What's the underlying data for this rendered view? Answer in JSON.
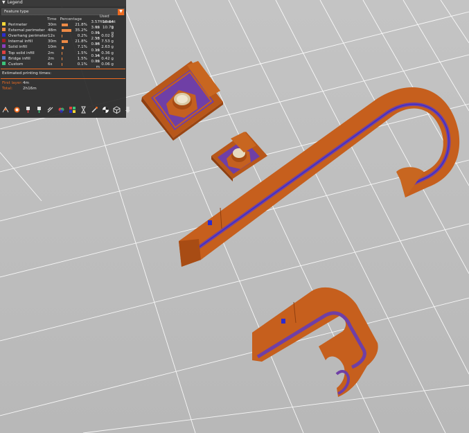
{
  "legend": {
    "title": "Legend",
    "view_type": "Feature type",
    "columns": {
      "time": "Time",
      "percentage": "Percentage",
      "used": "Used filament"
    },
    "rows": [
      {
        "name": "Perimeter",
        "time": "30m",
        "pct": "21.8%",
        "length": "3.57 m",
        "weight": "10.64 g",
        "color": "#f5d838",
        "bar": 0.218
      },
      {
        "name": "External perimeter",
        "time": "48m",
        "pct": "35.2%",
        "length": "3.62 m",
        "weight": "10.79 g",
        "color": "#ed8a45",
        "bar": 0.352
      },
      {
        "name": "Overhang perimeter",
        "time": "12s",
        "pct": "0.2%",
        "length": "0.01 m",
        "weight": "0.02 g",
        "color": "#2b2bd0",
        "bar": 0.002
      },
      {
        "name": "Internal infill",
        "time": "30m",
        "pct": "21.8%",
        "length": "2.53 m",
        "weight": "7.53 g",
        "color": "#a01f1f",
        "bar": 0.218
      },
      {
        "name": "Solid infill",
        "time": "10m",
        "pct": "7.1%",
        "length": "0.88 m",
        "weight": "2.63 g",
        "color": "#8c3fbf",
        "bar": 0.071
      },
      {
        "name": "Top solid infill",
        "time": "2m",
        "pct": "1.5%",
        "length": "0.12 m",
        "weight": "0.36 g",
        "color": "#e04040",
        "bar": 0.015
      },
      {
        "name": "Bridge infill",
        "time": "2m",
        "pct": "1.5%",
        "length": "0.14 m",
        "weight": "0.42 g",
        "color": "#5a78c8",
        "bar": 0.015
      },
      {
        "name": "Custom",
        "time": "6s",
        "pct": "0.1%",
        "length": "0.02 m",
        "weight": "0.06 g",
        "color": "#3cc47a",
        "bar": 0.001
      }
    ],
    "estimated_title": "Estimated printing times:",
    "first_layer_label": "First layer:",
    "first_layer_value": "4m",
    "total_label": "Total:",
    "total_value": "2h16m"
  },
  "toolbar": {
    "icons": [
      "travel-icon",
      "wipe-icon",
      "retractions-icon",
      "deretractions-icon",
      "seams-icon",
      "tool-changes-icon",
      "color-changes-icon",
      "pause-icon",
      "custom-gcode-icon",
      "center-of-gravity-icon",
      "shells-icon",
      "tool-marker-icon"
    ]
  },
  "colors": {
    "background": "#bfbfbf",
    "grid": "#ffffff",
    "model_orange": "#c65f1d",
    "model_purple": "#6f3fa6",
    "accent": "#ed6b21"
  }
}
